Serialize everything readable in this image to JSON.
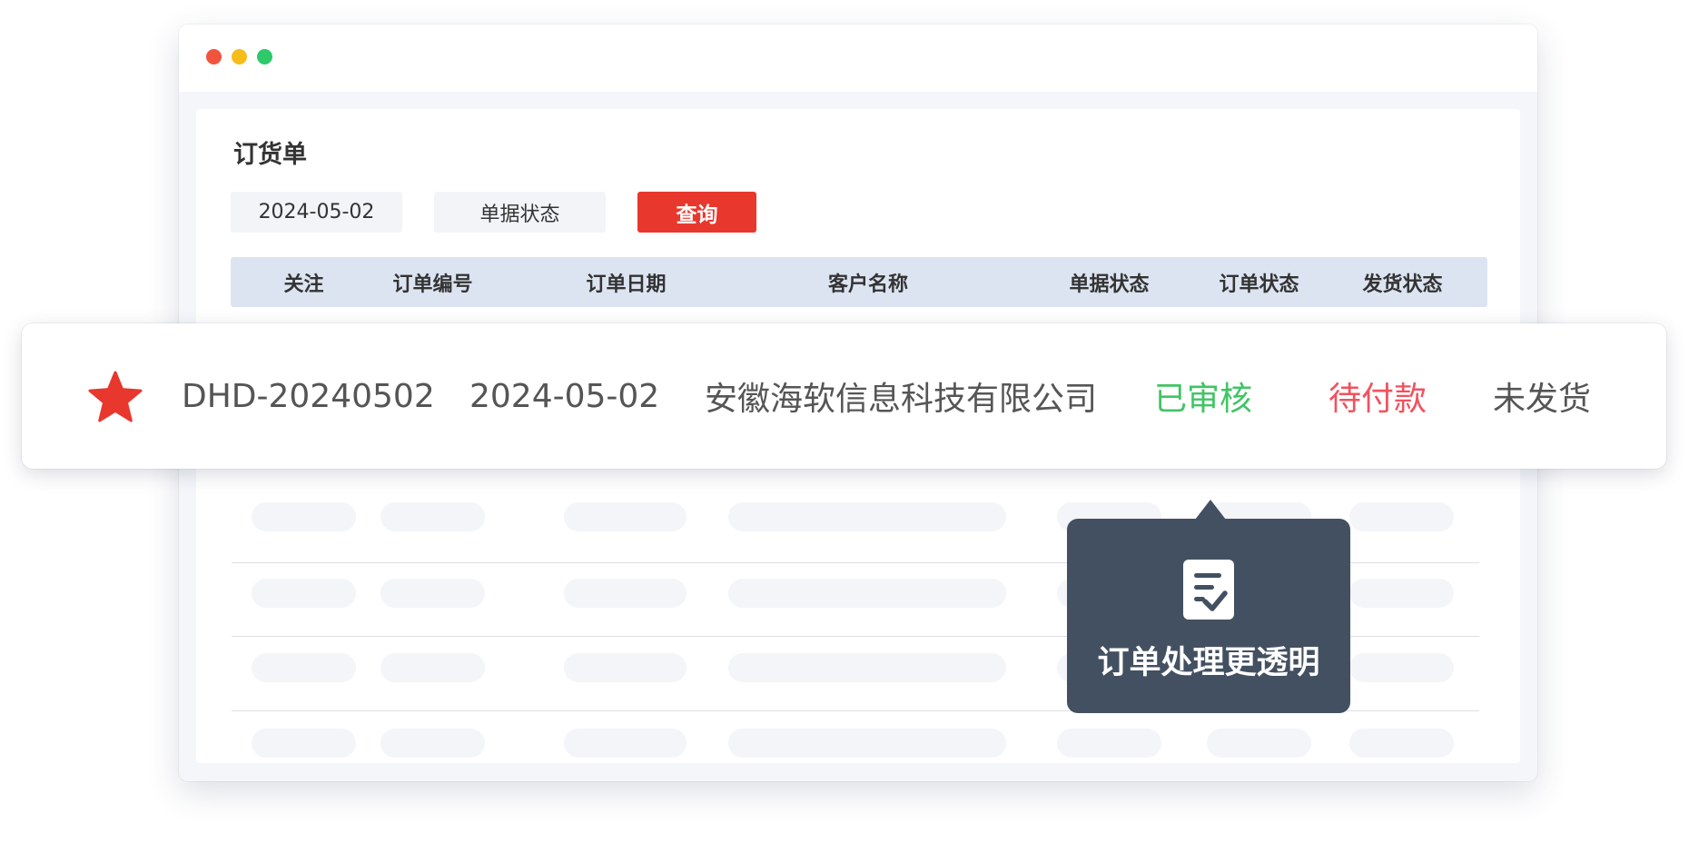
{
  "window": {
    "controls": [
      {
        "name": "close",
        "color": "#f2533f"
      },
      {
        "name": "minimize",
        "color": "#f6bc1a"
      },
      {
        "name": "maximize",
        "color": "#2dc96a"
      }
    ]
  },
  "page": {
    "title": "订货单"
  },
  "filters": {
    "date_value": "2024-05-02",
    "status_label": "单据状态",
    "query_label": "查询"
  },
  "table": {
    "headers": [
      "关注",
      "订单编号",
      "订单日期",
      "客户名称",
      "单据状态",
      "订单状态",
      "发货状态"
    ]
  },
  "highlighted_row": {
    "favorite_icon": "star-icon",
    "order_no": "DHD-20240502",
    "order_date": "2024-05-02",
    "customer": "安徽海软信息科技有限公司",
    "doc_status": "已审核",
    "order_status": "待付款",
    "shipping_status": "未发货"
  },
  "tooltip": {
    "icon": "checklist-icon",
    "text": "订单处理更透明"
  },
  "colors": {
    "accent_red": "#e8372d",
    "status_green": "#41c464",
    "status_red": "#f0525f",
    "tooltip_bg": "#435061",
    "header_bg": "#dde4f1"
  }
}
